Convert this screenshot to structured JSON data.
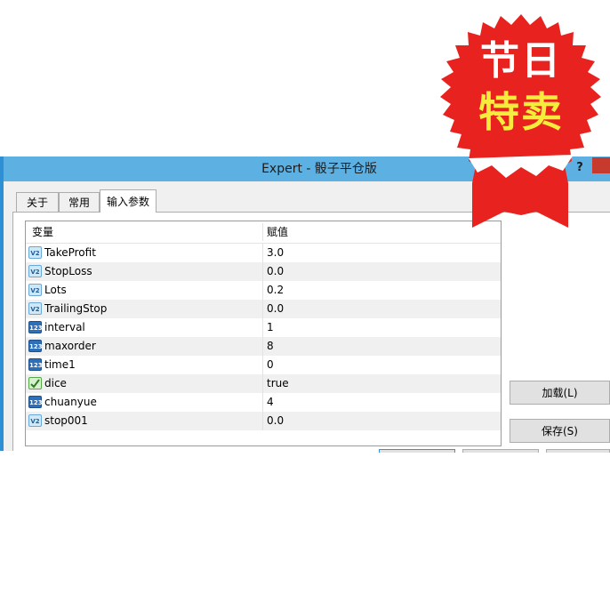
{
  "window": {
    "title": "Expert - 骰子平仓版",
    "help": "?"
  },
  "tabs": [
    {
      "label": "关于",
      "active": false
    },
    {
      "label": "常用",
      "active": false
    },
    {
      "label": "输入参数",
      "active": true
    }
  ],
  "table": {
    "headers": {
      "variable": "变量",
      "value": "赋值"
    },
    "rows": [
      {
        "name": "TakeProfit",
        "value": "3.0",
        "type_icon": "v2-icon"
      },
      {
        "name": "StopLoss",
        "value": "0.0",
        "type_icon": "v2-icon"
      },
      {
        "name": "Lots",
        "value": "0.2",
        "type_icon": "v2-icon"
      },
      {
        "name": "TrailingStop",
        "value": "0.0",
        "type_icon": "v2-icon"
      },
      {
        "name": "interval",
        "value": "1",
        "type_icon": "123-icon"
      },
      {
        "name": "maxorder",
        "value": "8",
        "type_icon": "123-icon"
      },
      {
        "name": "time1",
        "value": "0",
        "type_icon": "123-icon"
      },
      {
        "name": "dice",
        "value": "true",
        "type_icon": "bool-icon"
      },
      {
        "name": "chuanyue",
        "value": "4",
        "type_icon": "123-icon"
      },
      {
        "name": "stop001",
        "value": "0.0",
        "type_icon": "v2-icon"
      }
    ]
  },
  "buttons": {
    "load": "加载(L)",
    "save": "保存(S)"
  },
  "badge": {
    "line1": "节日",
    "line2": "特卖"
  },
  "colors": {
    "titlebar": "#5cb1e2",
    "badge_red": "#e8221f",
    "badge_yellow": "#f5ec3c"
  }
}
